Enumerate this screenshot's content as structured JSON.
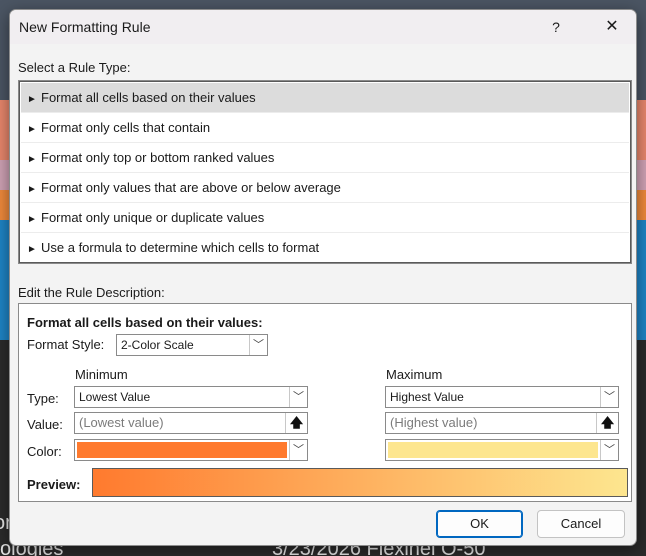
{
  "background": {
    "text_1": "or",
    "text_2": "ologies",
    "text_3": "3/23/2026 Flexinel O-50"
  },
  "dialog": {
    "title": "New Formatting Rule",
    "help_glyph": "?",
    "close_glyph": "✕"
  },
  "rule_type": {
    "label": "Select a Rule Type:",
    "items": [
      {
        "label": "Format all cells based on their values",
        "selected": true
      },
      {
        "label": "Format only cells that contain"
      },
      {
        "label": "Format only top or bottom ranked values"
      },
      {
        "label": "Format only values that are above or below average"
      },
      {
        "label": "Format only unique or duplicate values"
      },
      {
        "label": "Use a formula to determine which cells to format"
      }
    ],
    "arrow_glyph": "►"
  },
  "description": {
    "label": "Edit the Rule Description:",
    "title": "Format all cells based on their values:",
    "format_style_label": "Format Style:",
    "format_style_value": "2-Color Scale",
    "minimum_label": "Minimum",
    "maximum_label": "Maximum",
    "type_label": "Type:",
    "value_label": "Value:",
    "color_label": "Color:",
    "min_type": "Lowest Value",
    "max_type": "Highest Value",
    "min_value_placeholder": "(Lowest value)",
    "max_value_placeholder": "(Highest value)",
    "min_color": "#ff7a2e",
    "max_color": "#fde68f",
    "preview_label": "Preview:"
  },
  "buttons": {
    "ok": "OK",
    "cancel": "Cancel"
  },
  "icons": {
    "chevron": "﹀",
    "ref": "🡅"
  }
}
